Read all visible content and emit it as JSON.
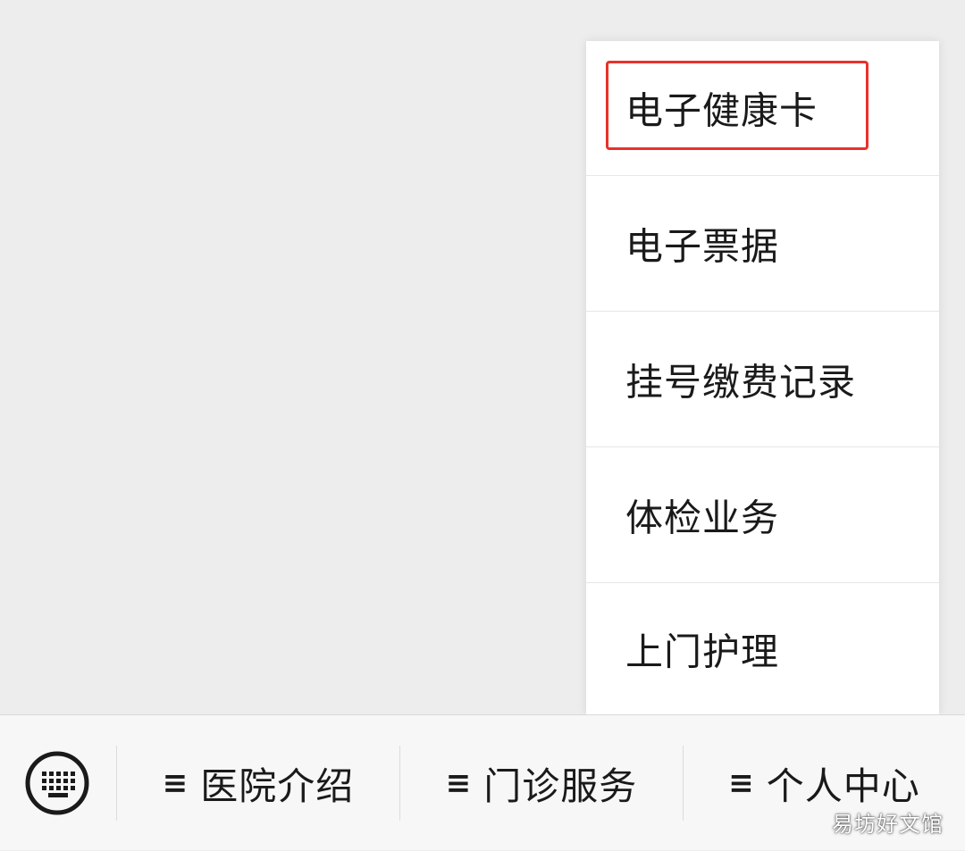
{
  "submenu": {
    "items": [
      {
        "label": "电子健康卡",
        "highlighted": true
      },
      {
        "label": "电子票据"
      },
      {
        "label": "挂号缴费记录"
      },
      {
        "label": "体检业务"
      },
      {
        "label": "上门护理"
      }
    ],
    "highlight_color": "#e8322b"
  },
  "bottom_bar": {
    "keyboard_icon": "keyboard-icon",
    "menus": [
      {
        "glyph": "≡",
        "label": "医院介绍"
      },
      {
        "glyph": "≡",
        "label": "门诊服务"
      },
      {
        "glyph": "≡",
        "label": "个人中心"
      }
    ]
  },
  "watermark": "易坊好文馆"
}
